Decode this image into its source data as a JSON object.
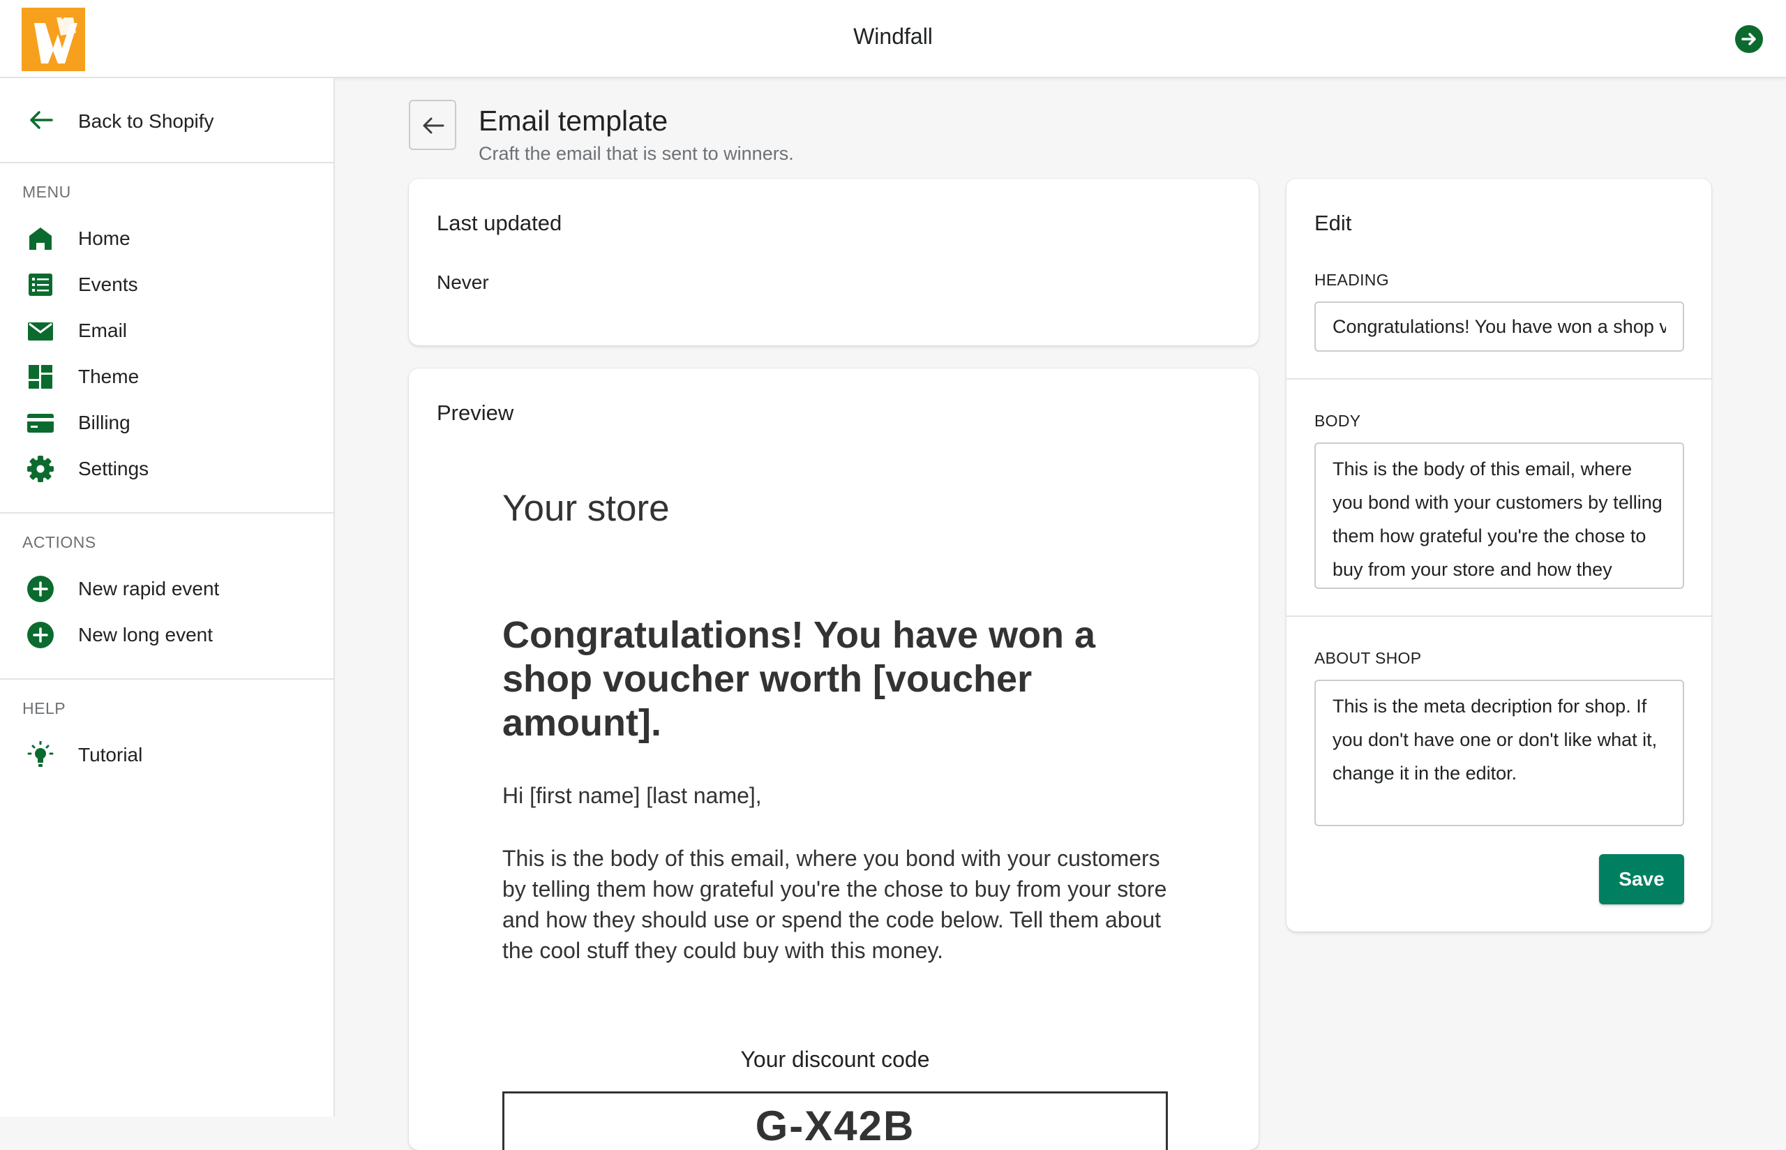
{
  "app": {
    "title": "Windfall"
  },
  "sidebar": {
    "back_label": "Back to Shopify",
    "menu_title": "MENU",
    "menu": [
      {
        "label": "Home",
        "icon": "home-icon"
      },
      {
        "label": "Events",
        "icon": "list-icon"
      },
      {
        "label": "Email",
        "icon": "envelope-icon"
      },
      {
        "label": "Theme",
        "icon": "layout-icon"
      },
      {
        "label": "Billing",
        "icon": "credit-card-icon"
      },
      {
        "label": "Settings",
        "icon": "gear-icon"
      }
    ],
    "actions_title": "ACTIONS",
    "actions": [
      {
        "label": "New rapid event",
        "icon": "plus-circle-icon"
      },
      {
        "label": "New long event",
        "icon": "plus-circle-icon"
      }
    ],
    "help_title": "HELP",
    "help": [
      {
        "label": "Tutorial",
        "icon": "lightbulb-icon"
      }
    ]
  },
  "page": {
    "title": "Email template",
    "subtitle": "Craft the email that is sent to winners."
  },
  "last_updated": {
    "title": "Last updated",
    "value": "Never"
  },
  "preview": {
    "title": "Preview",
    "store_name": "Your store",
    "heading": "Congratulations! You have won a shop voucher worth [voucher amount].",
    "greeting": "Hi [first name] [last name],",
    "body": "This is the body of this email, where you bond with your customers by telling them how grateful you're the chose to buy from your store and how they should use or spend the code below. Tell them about the cool stuff they could buy with this money.",
    "code_label": "Your discount code",
    "code": "G-X42B"
  },
  "edit": {
    "title": "Edit",
    "heading_label": "HEADING",
    "heading_value": "Congratulations! You have won a shop voucher worth [voucher amount].",
    "body_label": "BODY",
    "body_value": "This is the body of this email, where you bond with your customers by telling them how grateful you're the chose to buy from your store and how they should use or spend the code below. Tell them about the cool stuff they could buy with this money.",
    "about_label": "ABOUT SHOP",
    "about_value": "This is the meta decription for shop. If you don't have one or don't like what it, change it in the editor.",
    "save_label": "Save"
  },
  "colors": {
    "brand_green": "#0b6b2f",
    "primary_button": "#008060",
    "logo_orange": "#f7a01d"
  }
}
